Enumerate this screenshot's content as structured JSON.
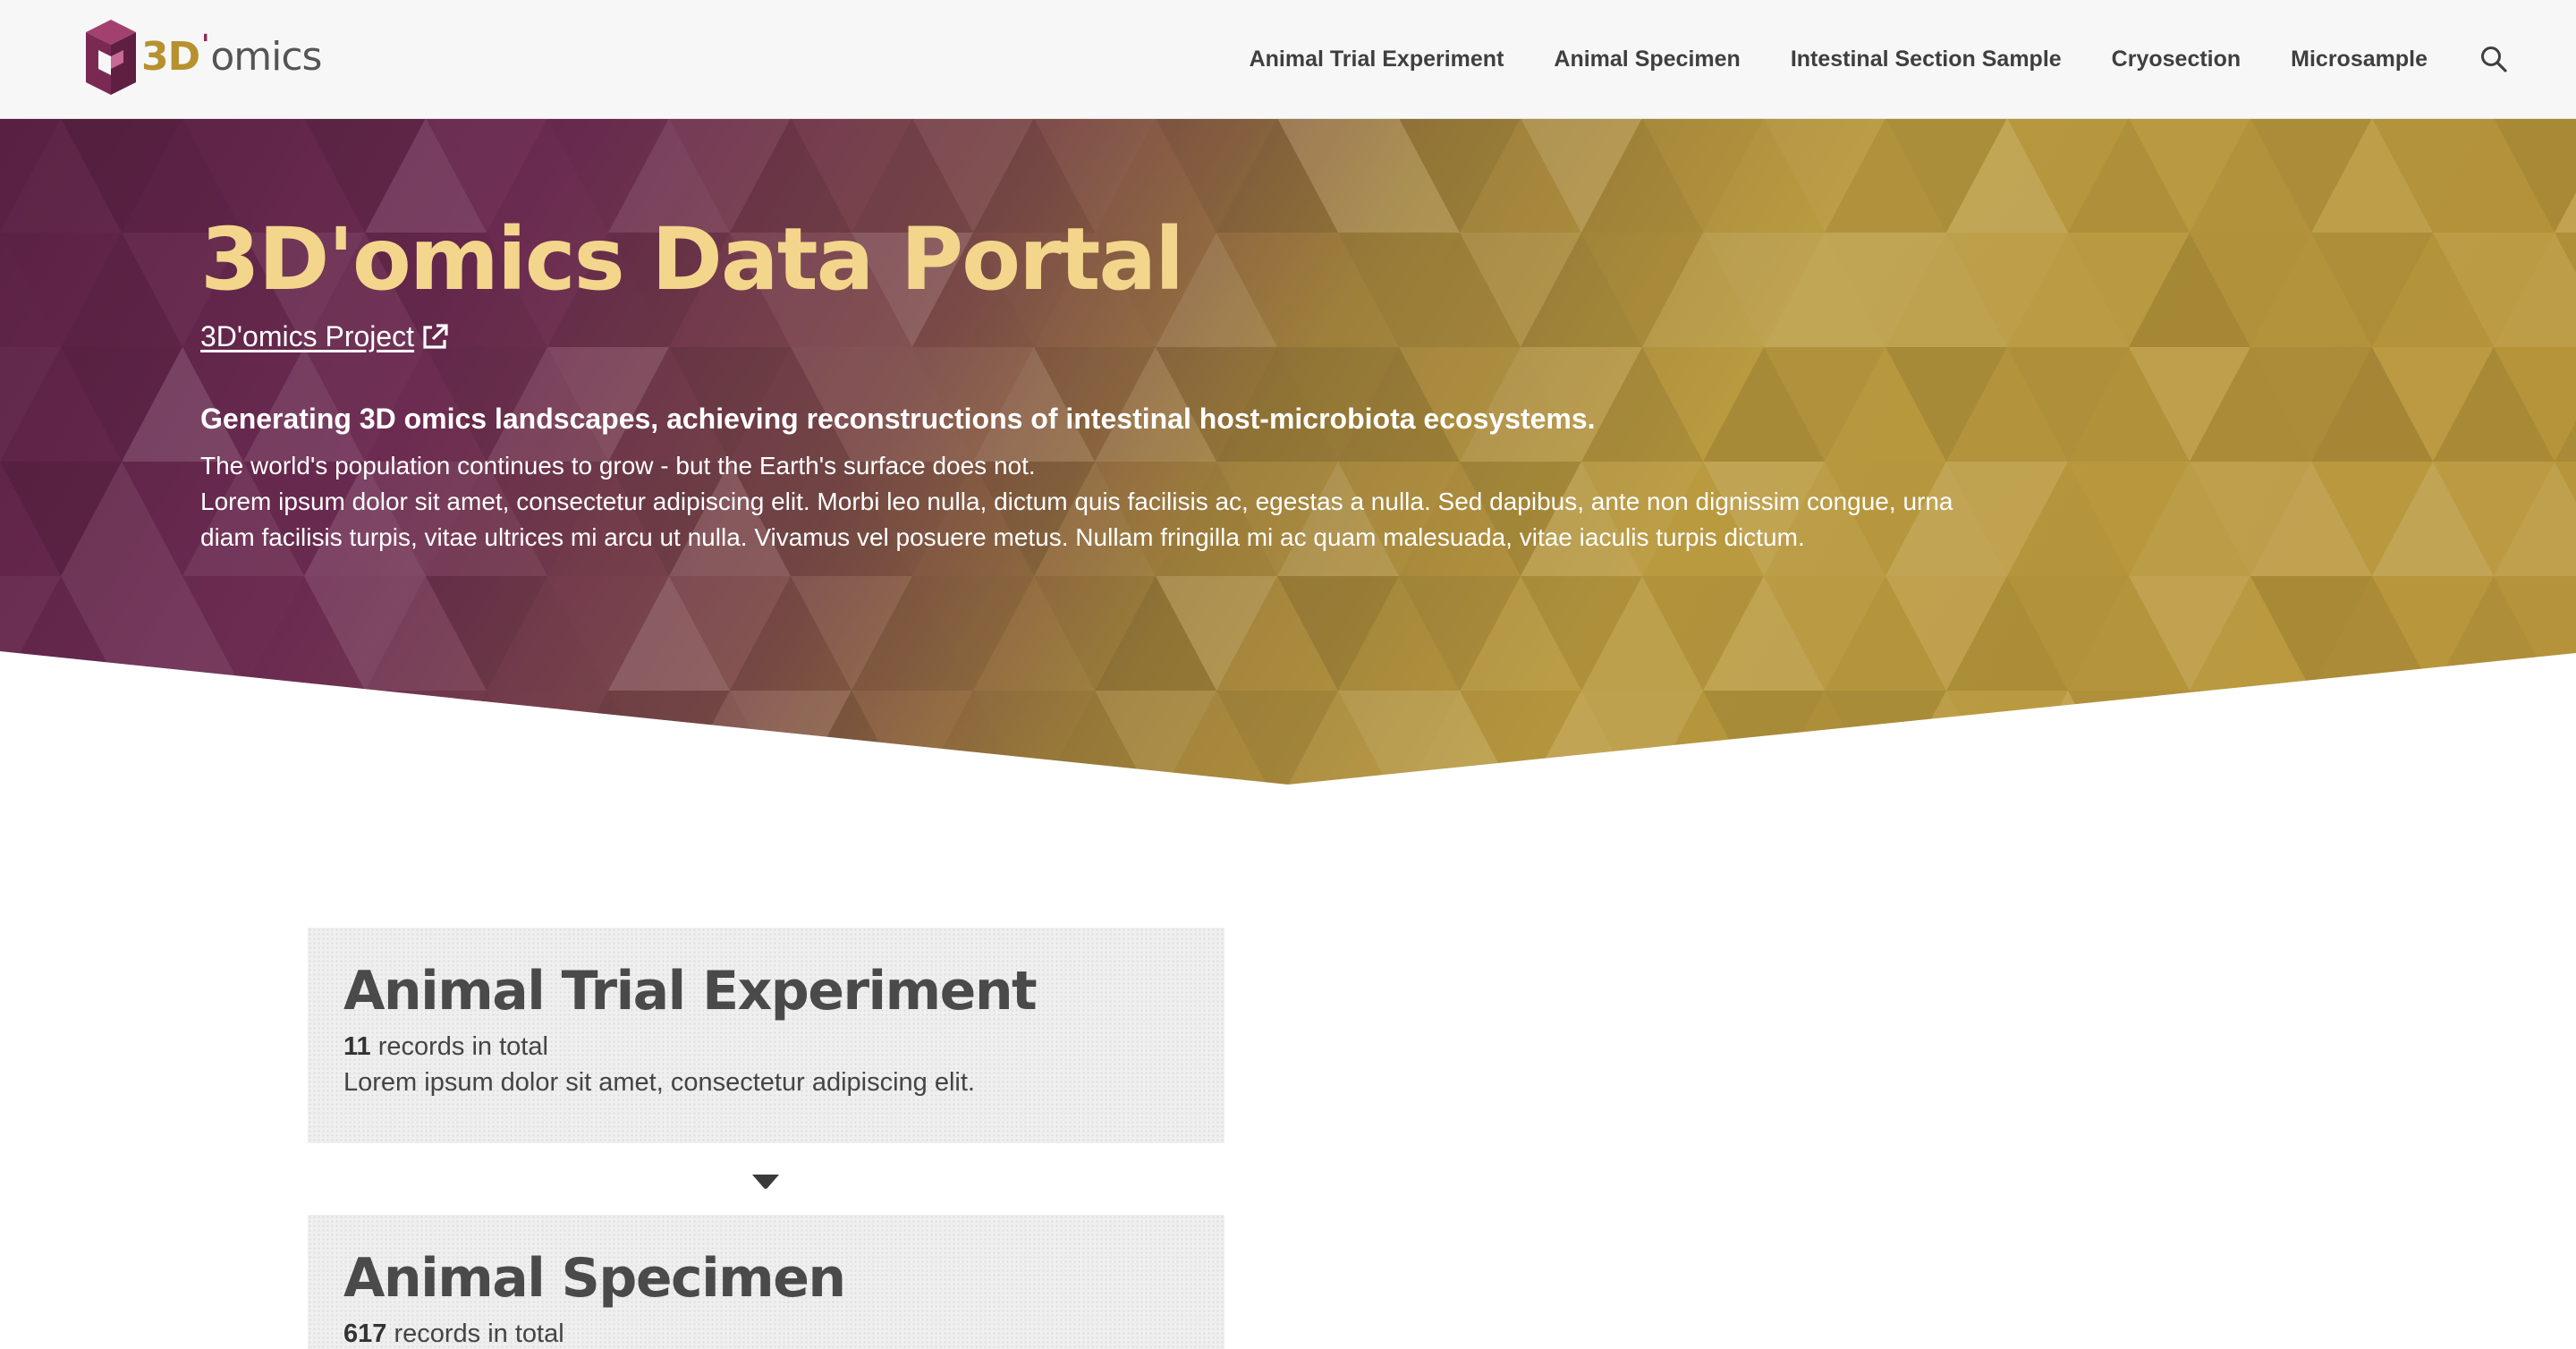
{
  "header": {
    "logo": {
      "prefix": "3D",
      "apostrophe": "'",
      "suffix": "omics",
      "colors": {
        "gold": "#b7912f",
        "plum": "#8a2f57",
        "grey": "#555555"
      }
    },
    "nav": [
      {
        "label": "Animal Trial Experiment"
      },
      {
        "label": "Animal Specimen"
      },
      {
        "label": "Intestinal Section Sample"
      },
      {
        "label": "Cryosection"
      },
      {
        "label": "Microsample"
      }
    ],
    "search_icon": "search-icon"
  },
  "hero": {
    "title": "3D'omics Data Portal",
    "project_link": "3D'omics Project",
    "project_link_icon": "external-link-icon",
    "tagline": "Generating 3D omics landscapes, achieving reconstructions of intestinal host-microbiota ecosystems.",
    "body": [
      "The world's population continues to grow - but the Earth's surface does not.",
      "Lorem ipsum dolor sit amet, consectetur adipiscing elit. Morbi leo nulla, dictum quis facilisis ac, egestas a nulla. Sed dapibus, ante non dignissim congue, urna diam facilisis turpis, vitae ultrices mi arcu ut nulla. Vivamus vel posuere metus. Nullam fringilla mi ac quam malesuada, vitae iaculis turpis dictum."
    ],
    "colors": {
      "plum": "#6b2a4f",
      "gold": "#b8982f",
      "title": "#f3d58c"
    }
  },
  "cards": [
    {
      "title": "Animal Trial Experiment",
      "count": "11",
      "count_suffix": " records in total",
      "description": "Lorem ipsum dolor sit amet, consectetur adipiscing elit."
    },
    {
      "title": "Animal Specimen",
      "count": "617",
      "count_suffix": " records in total"
    }
  ],
  "connector_icon": "caret-down-icon"
}
